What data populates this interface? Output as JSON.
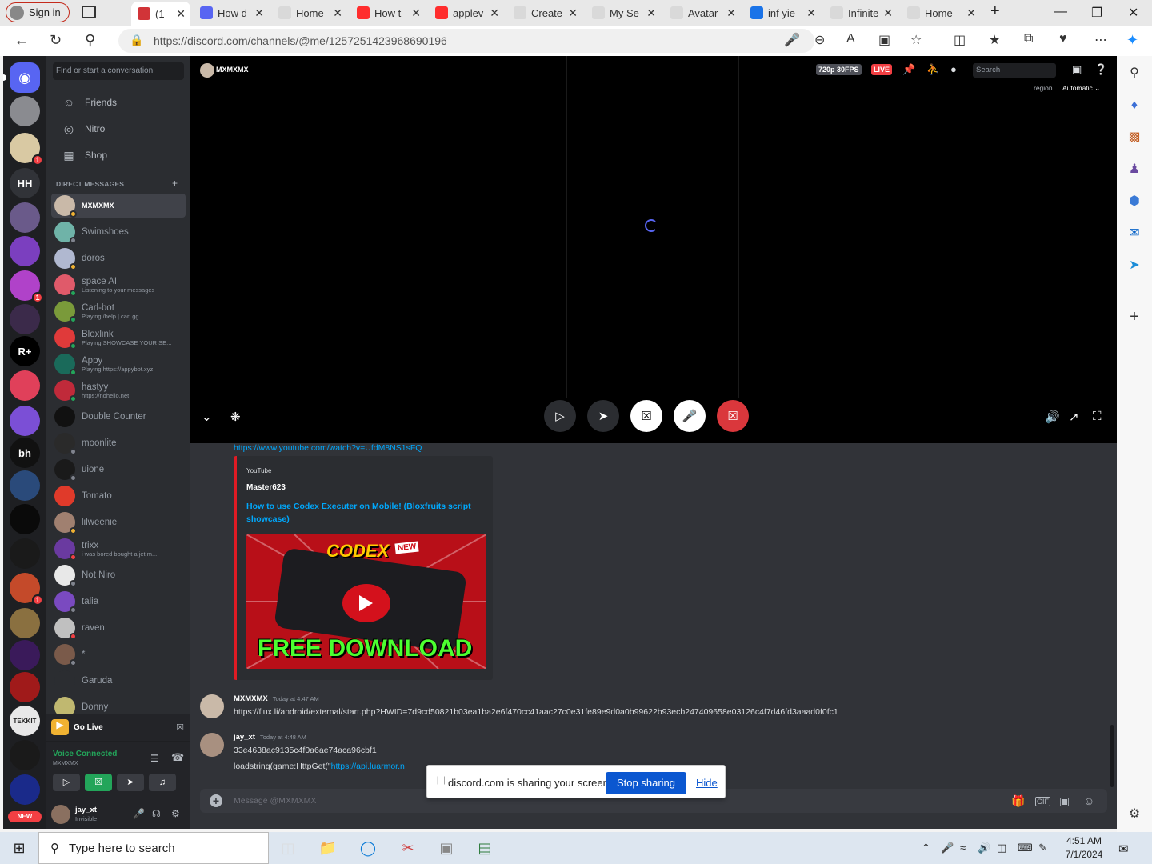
{
  "browser": {
    "signin_label": "Sign in",
    "tabs": [
      {
        "label": "(1",
        "color": "#d13438"
      },
      {
        "label": "How d",
        "color": "#5865f2"
      },
      {
        "label": "Home",
        "color": "#d9d9d9"
      },
      {
        "label": "How t",
        "color": "#ff2d2d"
      },
      {
        "label": "applev",
        "color": "#ff2d2d"
      },
      {
        "label": "Create",
        "color": "#d9d9d9"
      },
      {
        "label": "My Se",
        "color": "#d9d9d9"
      },
      {
        "label": "Avatar",
        "color": "#d9d9d9"
      },
      {
        "label": "inf yie",
        "color": "#1a73e8"
      },
      {
        "label": "Infinite",
        "color": "#d9d9d9"
      },
      {
        "label": "Home",
        "color": "#d9d9d9"
      }
    ],
    "url": "https://discord.com/channels/@me/1257251423968690196"
  },
  "guilds": [
    {
      "label": "",
      "color": "#5865f2",
      "badge": ""
    },
    {
      "label": "",
      "color": "#8a8b90",
      "badge": ""
    },
    {
      "label": "",
      "color": "#d9c9a3",
      "badge": "1"
    },
    {
      "label": "HH",
      "color": "#313338",
      "badge": ""
    },
    {
      "label": "",
      "color": "#6a5a8a",
      "badge": ""
    },
    {
      "label": "",
      "color": "#7b3fbf",
      "badge": ""
    },
    {
      "label": "",
      "color": "#b042c9",
      "badge": "1"
    },
    {
      "label": "",
      "color": "#3b2a4a",
      "badge": ""
    },
    {
      "label": "R+",
      "color": "#000000",
      "badge": ""
    },
    {
      "label": "",
      "color": "#e0405a",
      "badge": ""
    },
    {
      "label": "",
      "color": "#7b4fd6",
      "badge": ""
    },
    {
      "label": "bh",
      "color": "#111111",
      "badge": ""
    },
    {
      "label": "",
      "color": "#2a4a7a",
      "badge": ""
    },
    {
      "label": "",
      "color": "#0a0a0a",
      "badge": ""
    },
    {
      "label": "",
      "color": "#1a1a1a",
      "badge": ""
    },
    {
      "label": "",
      "color": "#c44a2a",
      "badge": "1"
    },
    {
      "label": "",
      "color": "#8a7040",
      "badge": ""
    },
    {
      "label": "",
      "color": "#3a1a5a",
      "badge": ""
    },
    {
      "label": "",
      "color": "#a01a1a",
      "badge": ""
    },
    {
      "label": "TEKKIT",
      "color": "#e8e8e8",
      "badge": ""
    },
    {
      "label": "",
      "color": "#1a1a1a",
      "badge": ""
    },
    {
      "label": "",
      "color": "#1a2a8a",
      "badge": ""
    }
  ],
  "new_badge": "NEW",
  "dms": {
    "search_placeholder": "Find or start a conversation",
    "nav": [
      {
        "label": "Friends",
        "icon": "friends-icon"
      },
      {
        "label": "Nitro",
        "icon": "nitro-icon"
      },
      {
        "label": "Shop",
        "icon": "shop-icon"
      }
    ],
    "header": "DIRECT MESSAGES",
    "list": [
      {
        "name": "MXMXMX",
        "sub": "",
        "color": "#c9b9a8",
        "status": "#f0b232"
      },
      {
        "name": "Swimshoes",
        "sub": "",
        "color": "#6fb3a8",
        "status": "#80848e"
      },
      {
        "name": "doros",
        "sub": "",
        "color": "#b0b8d0",
        "status": "#f0b232"
      },
      {
        "name": "space AI",
        "sub": "Listening to your messages",
        "color": "#e05a6a",
        "status": "#23a55a"
      },
      {
        "name": "Carl-bot",
        "sub": "Playing /help | carl.gg",
        "color": "#7a9a3a",
        "status": "#23a55a"
      },
      {
        "name": "Bloxlink",
        "sub": "Playing SHOWCASE YOUR SE...",
        "color": "#e03a3a",
        "status": "#23a55a"
      },
      {
        "name": "Appy",
        "sub": "Playing https://appybot.xyz",
        "color": "#1a6a5a",
        "status": "#23a55a"
      },
      {
        "name": "hastyy",
        "sub": "https://nohello.net",
        "color": "#c02a3a",
        "status": "#23a55a"
      },
      {
        "name": "Double Counter",
        "sub": "",
        "color": "#111111",
        "status": ""
      },
      {
        "name": "moonlite",
        "sub": "",
        "color": "#2a2a2a",
        "status": "#80848e"
      },
      {
        "name": "uione",
        "sub": "",
        "color": "#1a1a1a",
        "status": "#80848e"
      },
      {
        "name": "Tomato",
        "sub": "",
        "color": "#e03a2a",
        "status": ""
      },
      {
        "name": "lilweenie",
        "sub": "",
        "color": "#a08070",
        "status": "#f0b232"
      },
      {
        "name": "trixx",
        "sub": "i was bored bought a jet m...",
        "color": "#6a3aa0",
        "status": "#f23f43"
      },
      {
        "name": "Not Niro",
        "sub": "",
        "color": "#e8e8e8",
        "status": "#80848e"
      },
      {
        "name": "talia",
        "sub": "",
        "color": "#7a4ac0",
        "status": "#80848e"
      },
      {
        "name": "raven",
        "sub": "",
        "color": "#c0c0c0",
        "status": "#f23f43"
      },
      {
        "name": "*",
        "sub": "",
        "color": "#7a5a4a",
        "status": "#80848e"
      },
      {
        "name": "Garuda",
        "sub": "",
        "color": "#2b2d31",
        "status": ""
      },
      {
        "name": "Donny",
        "sub": "",
        "color": "#c0b870",
        "status": ""
      }
    ]
  },
  "golive_label": "Go Live",
  "voice": {
    "title": "Voice Connected",
    "sub": "MXMXMX"
  },
  "user": {
    "name": "jay_xt",
    "status": "Invisible"
  },
  "stage": {
    "name": "MXMXMX",
    "quality": "720p 30FPS",
    "live": "LIVE",
    "search_placeholder": "Search",
    "region_label": "region",
    "region_value": "Automatic"
  },
  "chat": {
    "top_link": "https://www.youtube.com/watch?v=UfdM8NS1sFQ",
    "embed": {
      "provider": "YouTube",
      "author": "Master623",
      "title": "How to use Codex Executer on Mobile! (Bloxfruits script showcase)",
      "thumb_big": "CODEX",
      "thumb_new": "NEW",
      "thumb_bottom": "FREE DOWNLOAD"
    },
    "messages": [
      {
        "user": "MXMXMX",
        "time": "Today at 4:47 AM",
        "lines": [
          "https://flux.li/android/external/start.php?HWID=7d9cd50821b03ea1ba2e6f470cc41aac27c0e31fe89e9d0a0b99622b93ecb247409658e03126c4f7d46fd3aaad0f0fc1"
        ]
      },
      {
        "user": "jay_xt",
        "time": "Today at 4:48 AM",
        "lines": [
          "33e4638ac9135c4f0a6ae74aca96cbf1",
          "loadstring(game:HttpGet(\""
        ],
        "line2_link": "https://api.luarmor.n"
      }
    ],
    "composer_placeholder": "Message @MXMXMX"
  },
  "share_bar": {
    "text": "discord.com is sharing your screen.",
    "stop": "Stop sharing",
    "hide": "Hide"
  },
  "taskbar": {
    "search_placeholder": "Type here to search",
    "time": "4:51 AM",
    "date": "7/1/2024"
  }
}
